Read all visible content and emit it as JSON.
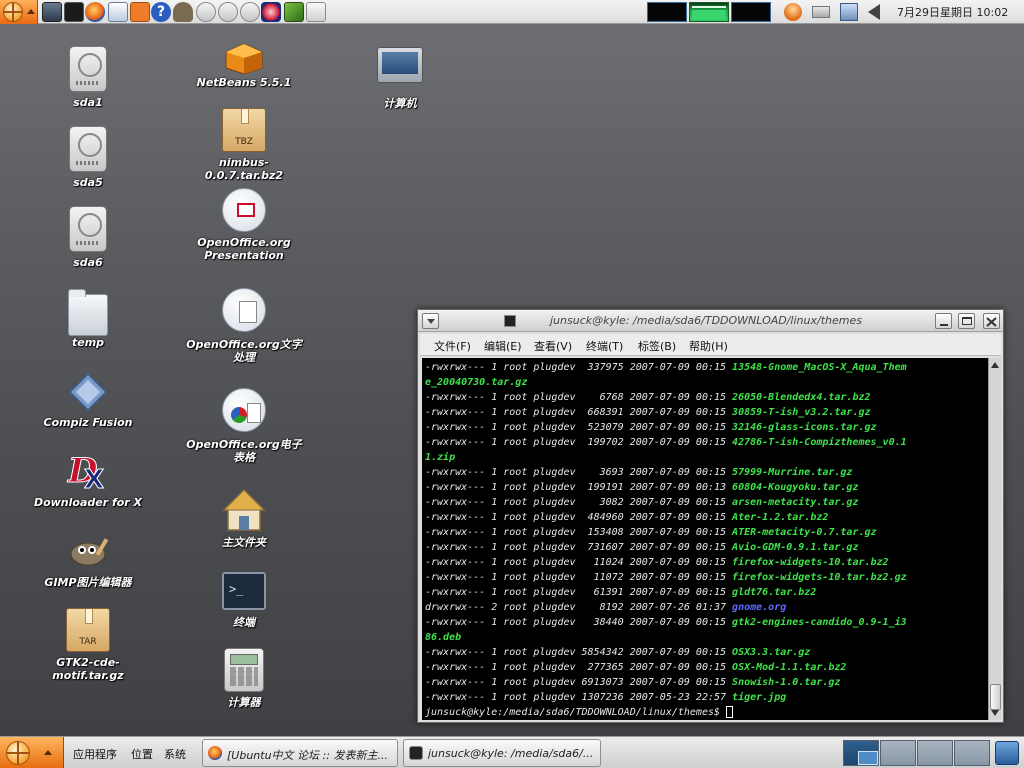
{
  "top_panel": {
    "clock": "7月29日星期日 10:02"
  },
  "desktop": {
    "icons": [
      {
        "label": "sda1"
      },
      {
        "label": "sda5"
      },
      {
        "label": "sda6"
      },
      {
        "label": "temp"
      },
      {
        "label": "Compiz Fusion"
      },
      {
        "label": "Downloader for X"
      },
      {
        "label": "GIMP图片编辑器"
      },
      {
        "label": "GTK2-cde-motif.tar.gz",
        "tag": "TAR"
      },
      {
        "label": "NetBeans 5.5.1"
      },
      {
        "label": "nimbus-0.0.7.tar.bz2",
        "tag": "TBZ"
      },
      {
        "label": "OpenOffice.org Presentation"
      },
      {
        "label": "OpenOffice.org文字处理"
      },
      {
        "label": "OpenOffice.org电子表格"
      },
      {
        "label": "主文件夹"
      },
      {
        "label": "终端"
      },
      {
        "label": "计算器"
      },
      {
        "label": "计算机"
      }
    ]
  },
  "terminal": {
    "title": "junsuck@kyle: /media/sda6/TDDOWNLOAD/linux/themes",
    "menu": [
      "文件(F)",
      "编辑(E)",
      "查看(V)",
      "终端(T)",
      "标签(B)",
      "帮助(H)"
    ],
    "lines": [
      {
        "meta": "-rwxrwx--- 1 root plugdev  337975 2007-07-09 00:15 ",
        "name": "13548-Gnome_MacOS-X_Aqua_Them"
      },
      {
        "meta": "",
        "name": "e_20040730.tar.gz"
      },
      {
        "meta": "-rwxrwx--- 1 root plugdev    6768 2007-07-09 00:15 ",
        "name": "26050-Blendedx4.tar.bz2"
      },
      {
        "meta": "-rwxrwx--- 1 root plugdev  668391 2007-07-09 00:15 ",
        "name": "30859-T-ish_v3.2.tar.gz"
      },
      {
        "meta": "-rwxrwx--- 1 root plugdev  523079 2007-07-09 00:15 ",
        "name": "32146-glass-icons.tar.gz"
      },
      {
        "meta": "-rwxrwx--- 1 root plugdev  199702 2007-07-09 00:15 ",
        "name": "42786-T-ish-Compizthemes_v0.1"
      },
      {
        "meta": "",
        "name": "1.zip"
      },
      {
        "meta": "-rwxrwx--- 1 root plugdev    3693 2007-07-09 00:15 ",
        "name": "57999-Murrine.tar.gz"
      },
      {
        "meta": "-rwxrwx--- 1 root plugdev  199191 2007-07-09 00:13 ",
        "name": "60804-Kougyoku.tar.gz"
      },
      {
        "meta": "-rwxrwx--- 1 root plugdev    3082 2007-07-09 00:15 ",
        "name": "arsen-metacity.tar.gz"
      },
      {
        "meta": "-rwxrwx--- 1 root plugdev  484960 2007-07-09 00:15 ",
        "name": "Ater-1.2.tar.bz2"
      },
      {
        "meta": "-rwxrwx--- 1 root plugdev  153408 2007-07-09 00:15 ",
        "name": "ATER-metacity-0.7.tar.gz"
      },
      {
        "meta": "-rwxrwx--- 1 root plugdev  731607 2007-07-09 00:15 ",
        "name": "Avio-GDM-0.9.1.tar.gz"
      },
      {
        "meta": "-rwxrwx--- 1 root plugdev   11024 2007-07-09 00:15 ",
        "name": "firefox-widgets-10.tar.bz2"
      },
      {
        "meta": "-rwxrwx--- 1 root plugdev   11072 2007-07-09 00:15 ",
        "name": "firefox-widgets-10.tar.bz2.gz"
      },
      {
        "meta": "-rwxrwx--- 1 root plugdev   61391 2007-07-09 00:15 ",
        "name": "gldt76.tar.bz2"
      },
      {
        "meta": "drwxrwx--- 2 root plugdev    8192 2007-07-26 01:37 ",
        "name": "gnome.org",
        "dir": true
      },
      {
        "meta": "-rwxrwx--- 1 root plugdev   38440 2007-07-09 00:15 ",
        "name": "gtk2-engines-candido_0.9-1_i3"
      },
      {
        "meta": "",
        "name": "86.deb"
      },
      {
        "meta": "-rwxrwx--- 1 root plugdev 5854342 2007-07-09 00:15 ",
        "name": "OSX3.3.tar.gz"
      },
      {
        "meta": "-rwxrwx--- 1 root plugdev  277365 2007-07-09 00:15 ",
        "name": "OSX-Mod-1.1.tar.bz2"
      },
      {
        "meta": "-rwxrwx--- 1 root plugdev 6913073 2007-07-09 00:15 ",
        "name": "Snowish-1.0.tar.gz"
      },
      {
        "meta": "-rwxrwx--- 1 root plugdev 1307236 2007-05-23 22:57 ",
        "name": "tiger.jpg"
      }
    ],
    "prompt": "junsuck@kyle:/media/sda6/TDDOWNLOAD/linux/themes$ "
  },
  "bottom_panel": {
    "menus": [
      "应用程序",
      "位置",
      "系统"
    ],
    "tasks": [
      {
        "label": "[Ubuntu中文 论坛 :: 发表新主..."
      },
      {
        "label": "junsuck@kyle: /media/sda6/..."
      }
    ]
  },
  "colors": {
    "accent_orange": "#e96a12",
    "terminal_file": "#3fe24a",
    "terminal_dir": "#5b6bff"
  }
}
